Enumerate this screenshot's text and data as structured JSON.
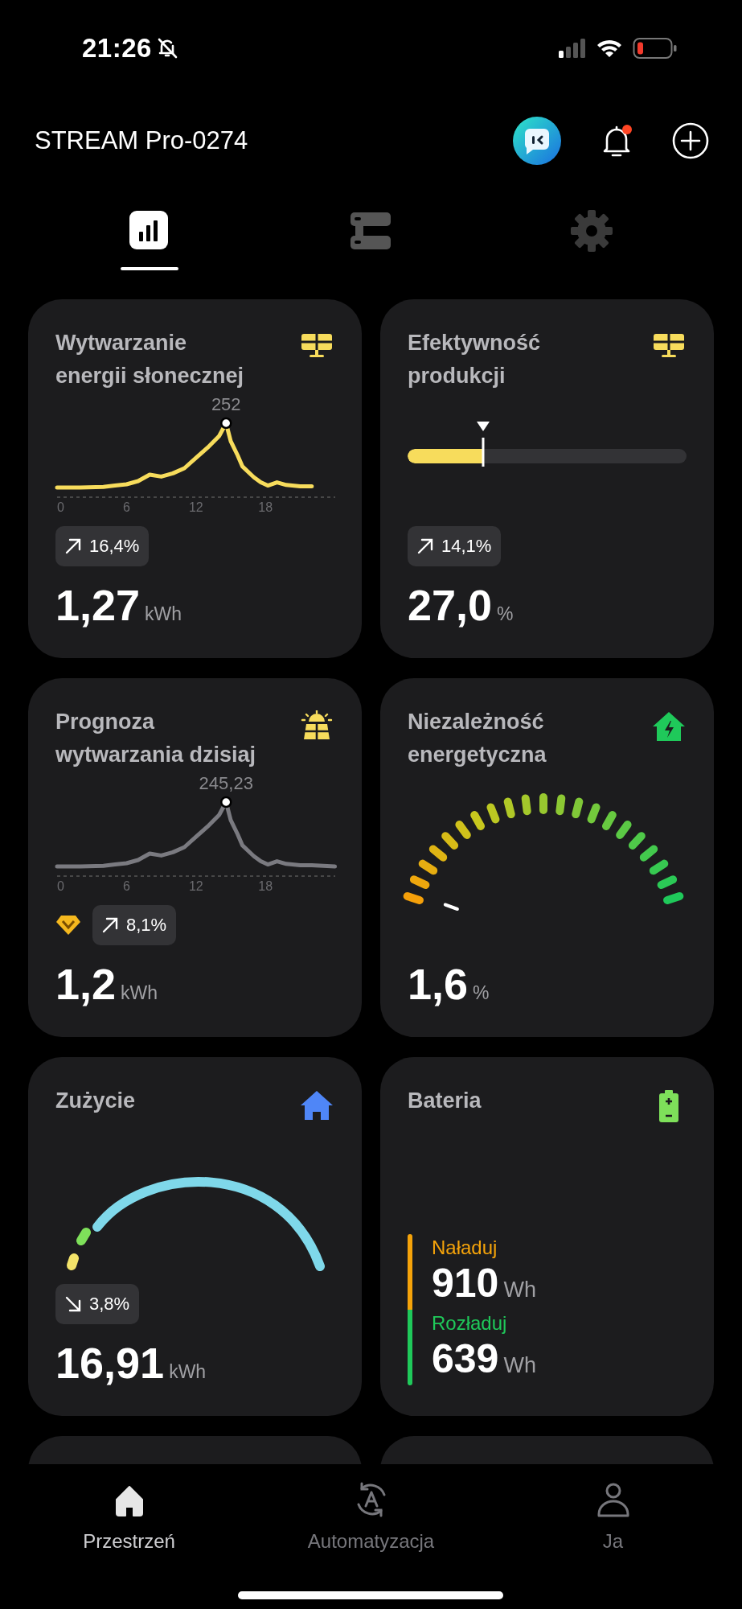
{
  "status_bar": {
    "time": "21:26",
    "silent": true
  },
  "header": {
    "title": "STREAM Pro-0274",
    "notification_dot": true
  },
  "tabs": [
    {
      "selected": true
    },
    {
      "selected": false
    },
    {
      "selected": false
    }
  ],
  "cards": [
    {
      "kind": "sparkline",
      "title": "Wytwarzanie energii słonecznej",
      "peak_label": "252",
      "xticks": [
        "0",
        "6",
        "12",
        "18"
      ],
      "falling": false,
      "change": "16,4%",
      "value": "1,27",
      "unit": "kWh"
    },
    {
      "kind": "bar",
      "title": "Efektywność produkcji",
      "level": 0.27,
      "falling": false,
      "change": "14,1%",
      "value": "27,0",
      "unit": "%"
    },
    {
      "kind": "sparkline",
      "title": "Prognoza wytwarzania dzisiaj",
      "peak_label": "245,23",
      "xticks": [
        "0",
        "6",
        "12",
        "18"
      ],
      "premium": true,
      "falling": false,
      "change": "8,1%",
      "value": "1,2",
      "unit": "kWh"
    },
    {
      "kind": "gauge",
      "title": "Niezależność energetyczna",
      "value": "1,6",
      "unit": "%"
    },
    {
      "kind": "arc",
      "title": "Zużycie",
      "falling": true,
      "change": "3,8%",
      "value": "16,91",
      "unit": "kWh"
    },
    {
      "kind": "battery",
      "title": "Bateria",
      "entries": [
        {
          "label": "Naładuj",
          "value": "910",
          "unit": "Wh",
          "color": "#f5a30a"
        },
        {
          "label": "Rozładuj",
          "value": "639",
          "unit": "Wh",
          "color": "#1fc95a"
        }
      ]
    },
    {
      "kind": "partial"
    },
    {
      "kind": "partial"
    }
  ],
  "bottom_nav": [
    {
      "label": "Przestrzeń",
      "selected": true
    },
    {
      "label": "Automatyzacja",
      "selected": false
    },
    {
      "label": "Ja",
      "selected": false
    }
  ]
}
